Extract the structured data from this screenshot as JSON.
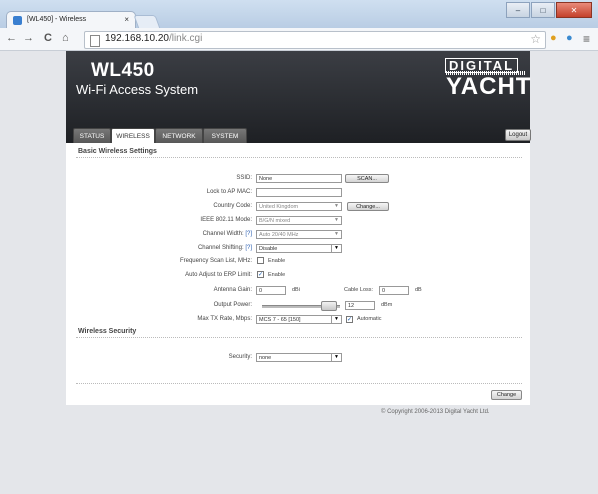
{
  "browser": {
    "tab_title": "[WL450] - Wireless",
    "tab_close": "×",
    "url_host": "192.168.10.20",
    "url_path": "/link.cgi",
    "window": {
      "minimize": "–",
      "maximize": "□",
      "close": "✕"
    },
    "nav": {
      "back": "←",
      "forward": "→",
      "reload": "C",
      "home": "⌂"
    },
    "star": "☆",
    "menu": "≡"
  },
  "banner": {
    "product": "WL450",
    "subtitle": "Wi-Fi Access System",
    "brand_top": "DIGITAL",
    "brand_bottom": "YACHT",
    "logout": "Logout"
  },
  "tabs": [
    {
      "label": "STATUS"
    },
    {
      "label": "WIRELESS",
      "active": true
    },
    {
      "label": "NETWORK"
    },
    {
      "label": "SYSTEM"
    }
  ],
  "basic": {
    "heading": "Basic Wireless Settings",
    "ssid_label": "SSID:",
    "ssid_value": "None",
    "scan": "SCAN...",
    "lock_label": "Lock to AP MAC:",
    "lock_value": "",
    "country_label": "Country Code:",
    "country_value": "United Kingdom",
    "change_country": "Change...",
    "mode_label": "IEEE 802.11 Mode:",
    "mode_value": "B/G/N mixed",
    "cw_label": "Channel Width:",
    "cw_help": "[?]",
    "cw_value": "Auto 20/40 MHz",
    "cs_label": "Channel Shifting:",
    "cs_help": "[?]",
    "cs_value": "Disable",
    "fsl_label": "Frequency Scan List, MHz:",
    "fsl_enable": "Enable",
    "fsl_checked": false,
    "erp_label": "Auto Adjust to ERP Limit:",
    "erp_enable": "Enable",
    "erp_checked": true,
    "gain_label": "Antenna Gain:",
    "gain_value": "0",
    "gain_unit": "dBi",
    "loss_label": "Cable Loss:",
    "loss_value": "0",
    "loss_unit": "dB",
    "power_label": "Output Power:",
    "power_value": "12",
    "power_unit": "dBm",
    "power_level": 0.92,
    "rate_label": "Max TX Rate, Mbps:",
    "rate_value": "MCS 7 - 65 [150]",
    "auto_label": "Automatic",
    "auto_checked": true
  },
  "security": {
    "heading": "Wireless Security",
    "label": "Security:",
    "value": "none"
  },
  "change": "Change",
  "copyright": "© Copyright 2006-2013 Digital Yacht Ltd."
}
